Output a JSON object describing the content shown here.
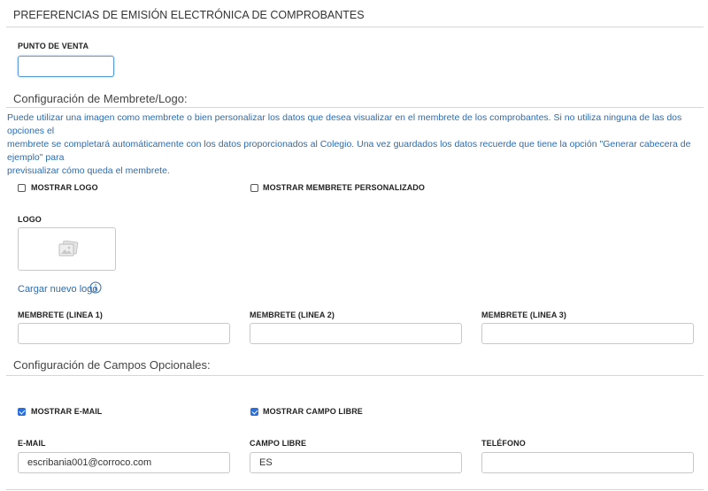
{
  "header": {
    "title": "PREFERENCIAS DE EMISIÓN ELECTRÓNICA DE COMPROBANTES"
  },
  "punto_venta": {
    "label": "PUNTO DE VENTA",
    "value": ""
  },
  "membrete": {
    "section_title": "Configuración de Membrete/Logo:",
    "info_line1": "Puede utilizar una imagen como membrete o bien personalizar los datos que desea visualizar en el membrete de los comprobantes. Si no utiliza ninguna de las dos opciones el",
    "info_line2": "membrete se completará automáticamente con los datos proporcionados al Colegio. Una vez guardados los datos recuerde que tiene la opción \"Generar cabecera de ejemplo\" para",
    "info_line3": "previsualizar cómo queda el membrete.",
    "show_logo_label": "MOSTRAR LOGO",
    "show_logo_checked": false,
    "show_custom_label": "MOSTRAR MEMBRETE PERSONALIZADO",
    "show_custom_checked": false,
    "logo_label": "LOGO",
    "upload_link": "Cargar nuevo logo",
    "line1_label": "MEMBRETE (LINEA 1)",
    "line1_value": "",
    "line2_label": "MEMBRETE (LINEA 2)",
    "line2_value": "",
    "line3_label": "MEMBRETE (LINEA 3)",
    "line3_value": ""
  },
  "optional": {
    "section_title": "Configuración de Campos Opcionales:",
    "show_email_label": "MOSTRAR E-MAIL",
    "show_email_checked": true,
    "show_free_label": "MOSTRAR CAMPO LIBRE",
    "show_free_checked": true,
    "email_label": "E-MAIL",
    "email_value": "escribania001@corroco.com",
    "free_label": "CAMPO LIBRE",
    "free_value": "ES",
    "phone_label": "TELÉFONO",
    "phone_value": ""
  },
  "colors": {
    "accent": "#2a6fdb",
    "info_text": "#2b6cb0",
    "border": "#c8c8c8"
  }
}
